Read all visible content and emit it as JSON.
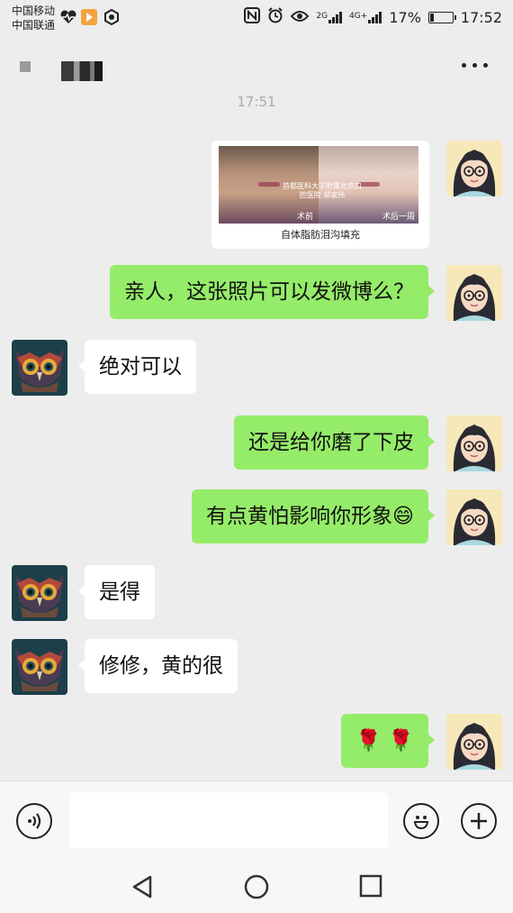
{
  "status_bar": {
    "carrier1": "中国移动",
    "carrier2": "中国联通",
    "network1": "2G",
    "network2": "4G+",
    "battery_percent": "17%",
    "battery_level": 0.17,
    "time": "17:52"
  },
  "timestamp": "17:51",
  "image_message": {
    "caption": "自体脂肪泪沟填充",
    "overlay_line1": "首都医科大学附属北京口",
    "overlay_line2": "腔医院 郑家伟",
    "label_before": "术前",
    "label_after": "术后一周"
  },
  "messages": [
    {
      "side": "me",
      "text": "亲人，这张照片可以发微博么？"
    },
    {
      "side": "them",
      "text": "绝对可以"
    },
    {
      "side": "me",
      "text": "还是给你磨了下皮"
    },
    {
      "side": "me",
      "text": "有点黄怕影响你形象😄"
    },
    {
      "side": "them",
      "text": "是得"
    },
    {
      "side": "them",
      "text": "修修，黄的很"
    },
    {
      "side": "me",
      "text": "🌹 🌹"
    }
  ],
  "icons": {
    "voice": "voice-icon",
    "emoji": "emoji-icon",
    "add": "plus-icon",
    "more": "more-icon",
    "back": "back-icon",
    "home": "home-icon",
    "recents": "recents-icon"
  },
  "colors": {
    "my_bubble": "#95ec69",
    "their_bubble": "#ffffff",
    "background": "#ededed"
  }
}
